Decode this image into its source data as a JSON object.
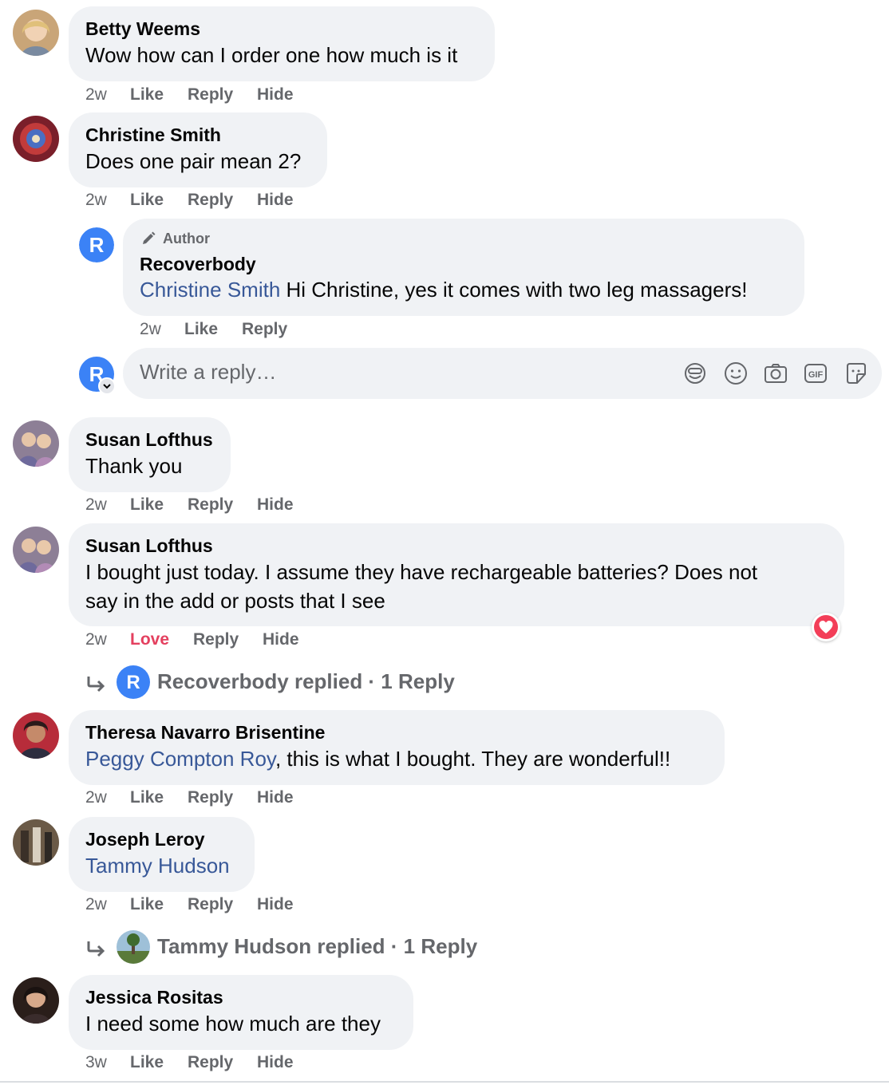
{
  "comments": [
    {
      "name": "Betty Weems",
      "text": "Wow how can I order one how much is it",
      "time": "2w",
      "like": "Like",
      "reply": "Reply",
      "hide": "Hide"
    },
    {
      "name": "Christine Smith",
      "text": "Does one pair mean 2?",
      "time": "2w",
      "like": "Like",
      "reply": "Reply",
      "hide": "Hide",
      "author_reply": {
        "badge": "Author",
        "name": "Recoverbody",
        "mention": "Christine Smith",
        "text": " Hi Christine, yes it comes with two leg massagers!",
        "time": "2w",
        "like": "Like",
        "reply": "Reply"
      },
      "composer": {
        "placeholder": "Write a reply…"
      }
    },
    {
      "name": "Susan Lofthus",
      "text": "Thank you",
      "time": "2w",
      "like": "Like",
      "reply": "Reply",
      "hide": "Hide"
    },
    {
      "name": "Susan Lofthus",
      "text_line1": "I bought just today. I assume they have rechargeable batteries? Does not",
      "text_line2": "say in the add or posts that I see",
      "time": "2w",
      "like": "Love",
      "reply": "Reply",
      "hide": "Hide",
      "replies_link": "Recoverbody replied · 1 Reply"
    },
    {
      "name": "Theresa Navarro Brisentine",
      "mention": "Peggy Compton Roy",
      "text": ", this is what I bought. They are wonderful!!",
      "time": "2w",
      "like": "Like",
      "reply": "Reply",
      "hide": "Hide"
    },
    {
      "name": "Joseph Leroy",
      "mention": "Tammy Hudson",
      "time": "2w",
      "like": "Like",
      "reply": "Reply",
      "hide": "Hide",
      "replies_link": "Tammy Hudson replied · 1 Reply"
    },
    {
      "name": "Jessica Rositas",
      "text": "I need some how much are they",
      "time": "3w",
      "like": "Like",
      "reply": "Reply",
      "hide": "Hide"
    }
  ],
  "icons": {
    "composer": [
      "avatar-sticker-icon",
      "emoji-icon",
      "camera-icon",
      "gif-icon",
      "sticker-icon"
    ],
    "edit": "pencil-icon",
    "reply_arrow": "reply-arrow-icon",
    "reaction": "love-reaction-icon"
  },
  "colors": {
    "bubble": "#f0f2f5",
    "secondary_text": "#65676b",
    "mention": "#385898",
    "love": "#e4405f",
    "brand": "#3b82f6"
  }
}
